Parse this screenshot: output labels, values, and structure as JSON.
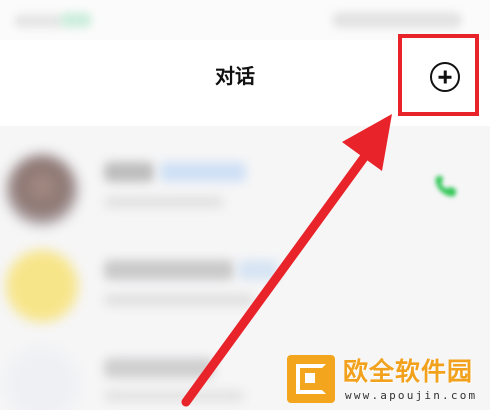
{
  "header": {
    "title": "对话",
    "add_icon": "plus-circle-icon"
  },
  "highlight": {
    "color": "#e8232a"
  },
  "list": {
    "call_icon": "phone-icon",
    "call_color": "#34c759"
  },
  "watermark": {
    "text": "欧全软件园",
    "url": "www.apoujin.com",
    "color": "#f2a11c"
  }
}
